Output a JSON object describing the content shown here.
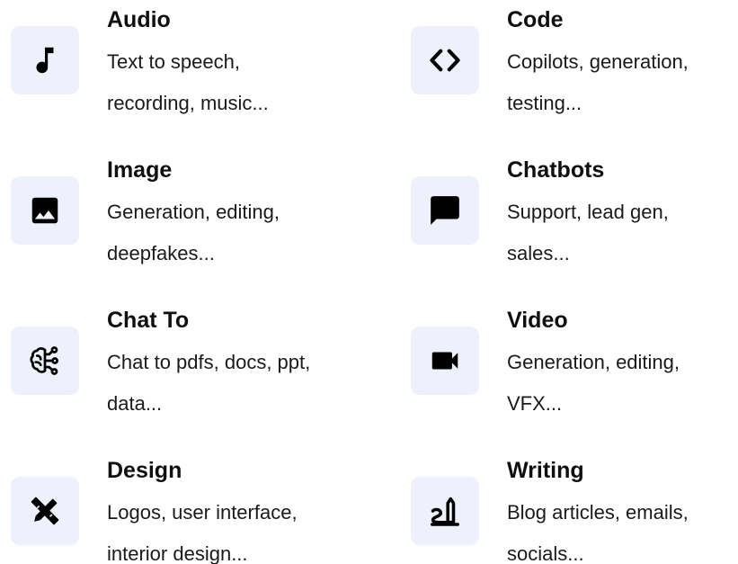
{
  "categories": [
    {
      "title": "Audio",
      "desc_line1": "Text to speech,",
      "desc_line2": "recording, music...",
      "icon": "music-note-icon"
    },
    {
      "title": "Code",
      "desc_line1": "Copilots, generation,",
      "desc_line2": "testing...",
      "icon": "code-brackets-icon"
    },
    {
      "title": "Image",
      "desc_line1": "Generation, editing,",
      "desc_line2": "deepfakes...",
      "icon": "image-icon"
    },
    {
      "title": "Chatbots",
      "desc_line1": "Support, lead gen,",
      "desc_line2": "sales...",
      "icon": "chat-bubble-icon"
    },
    {
      "title": "Chat To",
      "desc_line1": "Chat to pdfs, docs, ppt,",
      "desc_line2": "data...",
      "icon": "brain-circuit-icon"
    },
    {
      "title": "Video",
      "desc_line1": "Generation, editing,",
      "desc_line2": "VFX...",
      "icon": "video-camera-icon"
    },
    {
      "title": "Design",
      "desc_line1": "Logos, user interface,",
      "desc_line2": "interior design...",
      "icon": "design-tools-icon"
    },
    {
      "title": "Writing",
      "desc_line1": "Blog articles, emails,",
      "desc_line2": "socials...",
      "icon": "writing-pen-icon"
    }
  ],
  "colors": {
    "icon_bg": "#eef0fb",
    "icon_fg": "#000000",
    "text": "#111111"
  }
}
